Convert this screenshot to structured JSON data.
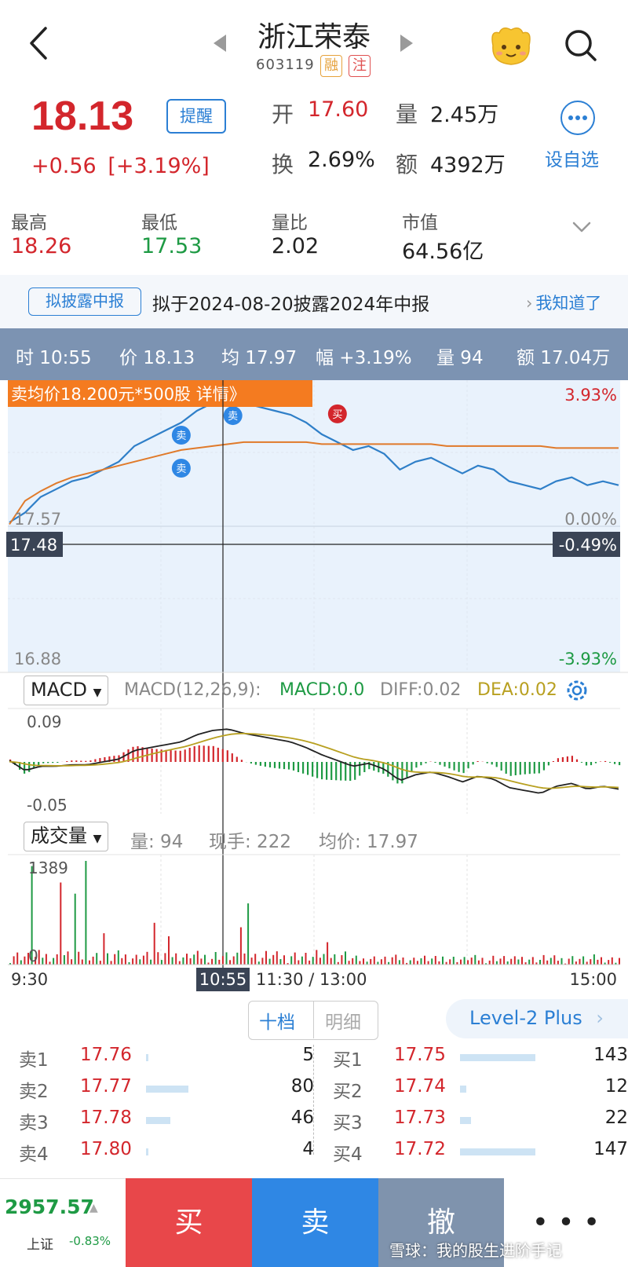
{
  "header": {
    "stock_name": "浙江荣泰",
    "stock_code": "603119",
    "tag_rong": "融",
    "tag_zhu": "注"
  },
  "quote": {
    "price": "18.13",
    "change": "+0.56",
    "change_pct": "[+3.19%]",
    "remind_label": "提醒",
    "open_label": "开",
    "open_value": "17.60",
    "volume_label": "量",
    "volume_value": "2.45万",
    "turnover_label": "换",
    "turnover_value": "2.69%",
    "amount_label": "额",
    "amount_value": "4392万",
    "set_fav_label": "设自选"
  },
  "stats": [
    {
      "label": "最高",
      "value": "18.26"
    },
    {
      "label": "最低",
      "value": "17.53"
    },
    {
      "label": "量比",
      "value": "2.02"
    },
    {
      "label": "市值",
      "value": "64.56亿"
    }
  ],
  "notice": {
    "tag": "拟披露中报",
    "text": "拟于2024-08-20披露2024年中报",
    "ack": "我知道了"
  },
  "cursor_info": {
    "time": "时 10:55",
    "price": "价 18.13",
    "avg": "均 17.97",
    "pct": "幅 +3.19%",
    "vol": "量 94",
    "amount": "额 17.04万"
  },
  "chart_data": [
    {
      "type": "line",
      "title": "",
      "trade_banner": "卖均价18.200元*500股 详情》",
      "y_left_labels": [
        "17.57",
        "16.88"
      ],
      "y_right_labels": [
        "3.93%",
        "0.00%",
        "-3.93%"
      ],
      "cursor_price": "17.48",
      "cursor_pct": "-0.49%",
      "trade_markers": [
        "卖",
        "卖",
        "卖",
        "买"
      ],
      "series": [
        {
          "name": "价",
          "color": "#2f7fc8",
          "values": [
            17.59,
            17.64,
            17.72,
            17.76,
            17.8,
            17.82,
            17.86,
            17.9,
            17.98,
            18.02,
            18.06,
            18.1,
            18.16,
            18.2,
            18.22,
            18.2,
            18.18,
            18.16,
            18.14,
            18.1,
            18.04,
            18.0,
            17.96,
            17.98,
            17.94,
            17.86,
            17.9,
            17.92,
            17.88,
            17.84,
            17.88,
            17.86,
            17.8,
            17.78,
            17.76,
            17.8,
            17.82,
            17.78,
            17.8,
            17.78
          ]
        },
        {
          "name": "均",
          "color": "#e07a2a",
          "values": [
            17.58,
            17.7,
            17.75,
            17.79,
            17.82,
            17.84,
            17.86,
            17.88,
            17.9,
            17.92,
            17.94,
            17.96,
            17.97,
            17.98,
            17.99,
            18.0,
            18.0,
            18.0,
            18.0,
            18.0,
            17.99,
            17.99,
            17.99,
            17.99,
            17.99,
            17.99,
            17.99,
            17.99,
            17.98,
            17.98,
            17.98,
            17.98,
            17.98,
            17.98,
            17.98,
            17.97,
            17.97,
            17.97,
            17.97,
            17.97
          ]
        }
      ]
    },
    {
      "type": "bar",
      "title": "MACD(12,26,9):",
      "selector": "MACD",
      "macd_label": "MACD:0.0",
      "diff_label": "DIFF:0.02",
      "dea_label": "DEA:0.02",
      "y_labels": [
        "0.09",
        "-0.05"
      ]
    },
    {
      "type": "bar",
      "selector": "成交量",
      "vol_label": "量: 94",
      "hand_label": "现手: 222",
      "avg_label": "均价: 17.97",
      "y_labels": [
        "1389",
        "0"
      ],
      "x_labels": [
        "9:30",
        "11:30 / 13:00",
        "15:00"
      ],
      "cursor_time": "10:55"
    }
  ],
  "orderbook": {
    "tab_ten": "十档",
    "tab_detail": "明细",
    "level2": "Level-2 Plus",
    "sells": [
      {
        "label": "卖1",
        "price": "17.76",
        "vol": "5",
        "fill": 0.03
      },
      {
        "label": "卖2",
        "price": "17.77",
        "vol": "80",
        "fill": 0.56
      },
      {
        "label": "卖3",
        "price": "17.78",
        "vol": "46",
        "fill": 0.32
      },
      {
        "label": "卖4",
        "price": "17.80",
        "vol": "4",
        "fill": 0.03
      }
    ],
    "buys": [
      {
        "label": "买1",
        "price": "17.75",
        "vol": "143",
        "fill": 1.0
      },
      {
        "label": "买2",
        "price": "17.74",
        "vol": "12",
        "fill": 0.08
      },
      {
        "label": "买3",
        "price": "17.73",
        "vol": "22",
        "fill": 0.15
      },
      {
        "label": "买4",
        "price": "17.72",
        "vol": "147",
        "fill": 1.0
      }
    ]
  },
  "bottom": {
    "index_value": "2957.57",
    "index_name": "上证",
    "index_change": "-0.83%",
    "buy": "买",
    "sell": "卖",
    "cancel": "撤",
    "more": "• • •",
    "watermark": "雪球：我的股生进阶手记"
  }
}
